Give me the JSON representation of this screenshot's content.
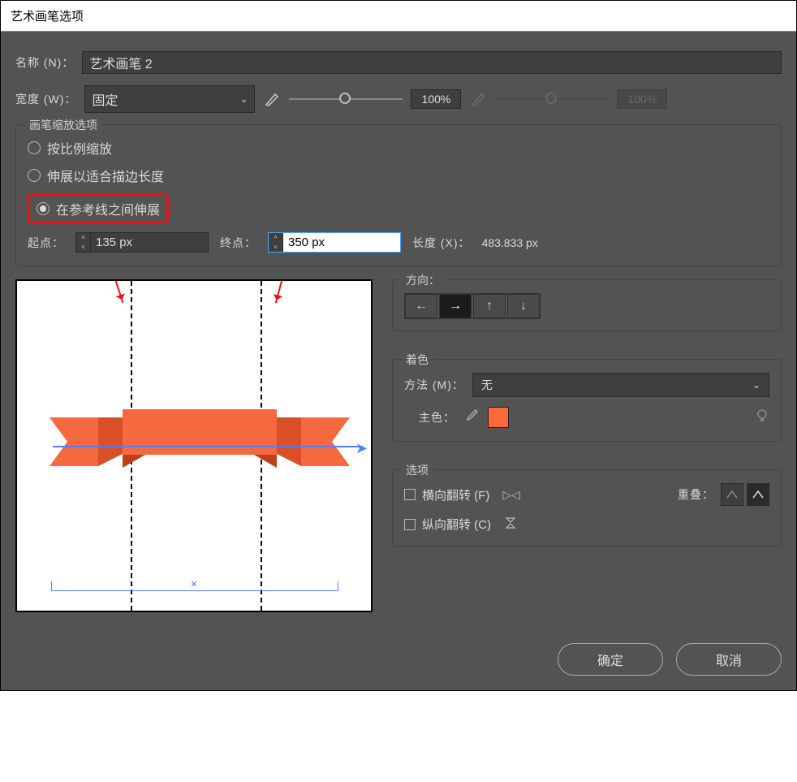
{
  "title": "艺术画笔选项",
  "name": {
    "label": "名称 (N)：",
    "value": "艺术画笔 2"
  },
  "width": {
    "label": "宽度 (W)：",
    "dropdown": "固定",
    "pct1": "100%",
    "pct2": "100%"
  },
  "scale_options": {
    "legend": "画笔缩放选项",
    "opt1": "按比例缩放",
    "opt2": "伸展以适合描边长度",
    "opt3": "在参考线之间伸展",
    "start_label": "起点：",
    "start_value": "135 px",
    "end_label": "终点：",
    "end_value": "350 px",
    "length_label": "长度 (X)：",
    "length_value": "483.833 px"
  },
  "direction": {
    "legend": "方向："
  },
  "colorize": {
    "legend": "着色",
    "method_label": "方法 (M)：",
    "method_value": "无",
    "key_label": "主色："
  },
  "options": {
    "legend": "选项",
    "flip_h": "横向翻转 (F)",
    "flip_v": "纵向翻转 (C)",
    "overlap_label": "重叠："
  },
  "footer": {
    "ok": "确定",
    "cancel": "取消"
  }
}
